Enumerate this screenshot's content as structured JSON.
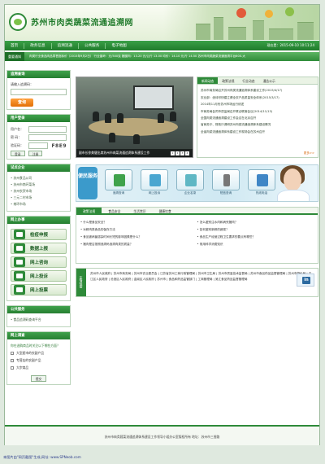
{
  "header": {
    "site_title": "苏州市肉类蔬菜流通追溯网"
  },
  "nav": {
    "items": [
      "首页",
      "政务信息",
      "追溯流通",
      "公共服务",
      "电子地图"
    ],
    "date": "现在是：2015-09-10 10:11:24"
  },
  "ticker": {
    "label": "重要通知",
    "text": "肉类行业食品肉品零售指标价（2015年9月2日）    行业普岭：元/500克  猪腿肉：13.20 元/公斤  13.00 均价：14.10 元/斤  14.50  苏州市肉类蔬菜流通追溯平台600-大"
  },
  "left": {
    "query_box": {
      "title": "追溯查询",
      "label": "请输入追溯码：",
      "button": "查询"
    },
    "login_box": {
      "title": "用户登录",
      "user_label": "用户名：",
      "pass_label": "密  码：",
      "captcha_label": "验证码：",
      "captcha_value": "F8E9",
      "login_btn": "登录",
      "register_btn": "注册"
    },
    "links_box": {
      "title": "试点企业",
      "items": [
        "• 苏州食品公司",
        "• 苏州市南环菜场",
        "• 苏州农贸市场",
        "• 三元二村市场",
        "• 南环市场"
      ]
    },
    "online_box": {
      "title": "网上办事",
      "items": [
        "检疫申报",
        "数据上报",
        "网上咨询",
        "网上投诉",
        "网上投票"
      ]
    },
    "notice_box": {
      "title": "公共服务",
      "item": "• 食品追溯码查询平台"
    },
    "poll_box": {
      "title": "网上调查",
      "question": "你在选购商品时关注以下哪些方面？",
      "options": [
        "大型超市的农副产品",
        "专营店的农副产品",
        "大宗商品"
      ],
      "submit": "提交"
    }
  },
  "slideshow": {
    "caption": "副市长徐美健出席苏州市肉菜流通追溯体系建设工作",
    "dots": [
      "1",
      "2",
      "3",
      "4"
    ]
  },
  "news": {
    "tabs": [
      "新闻动态",
      "政策法规",
      "行业动态",
      "通告公示"
    ],
    "items": [
      "苏州市商务局召开苏州肉类流通追溯体系建设工作(2015/4/17)",
      "农业部：亟待尽快建立健全农产品质量安全体系(2015/3/17)",
      "2014年11月份苏州市场运行综述",
      "市商务局会同市质监局召开联合联席会议(2014/11/13)",
      "全国肉类流通追溯建设工作会议在北京召开",
      "省商务厅、财政厅调研苏州肉菜流通追溯体系建设情况",
      "全省肉菜流通追溯体系建设工作现场会在苏州召开"
    ],
    "more": "更多>>"
  },
  "banner": {
    "tag": "便民服务",
    "items": [
      "追溯查询",
      "网上投诉",
      "企业名录",
      "短信查询",
      "热线电话"
    ]
  },
  "lower": {
    "tabs": [
      "政策法规",
      "食品安全",
      "生活常识",
      "健康饮食"
    ],
    "left_items": [
      "• 什么是食品安全？",
      "• 冰鲜肉类食品的保存方法",
      "• 食品被病菌感染时间长短的影响因素是什么？",
      "• 猪肉是否按照追溯码追溯肉类的质量？"
    ],
    "right_items": [
      "• 怎么鉴别注水肉和病死猪肉？",
      "• 如何鉴别新鲜的蔬菜？",
      "• 食品生产经营过程卫生要求的要点有哪些？",
      "• 常用科学消费知识"
    ]
  },
  "friend_links": {
    "tag": "友情链接",
    "text": "苏州市人民政府 | 苏州市商务局 | 苏州市农业委员会 | 江苏省苏州工商行政管理局 | 苏州市卫生局 | 苏州市质量技术监督局 | 苏州市食品药品监督管理局 | 苏州市物价局 | 平江区人民政府 | 沧浪区人民政府 | 金阊区人民政府 | 苏州市 | 食品和药品监管部门 | 工商管理局 | 吴江食品药品监督管理局"
  },
  "footer": {
    "text": "苏州市肉类蔬菜流通追溯体系建设工作领导小组办公室版权所有  地址：苏州市三香路"
  },
  "bottom_note": "本图片由\"网页截图\"生成,网址: www.SPNeob.com"
}
